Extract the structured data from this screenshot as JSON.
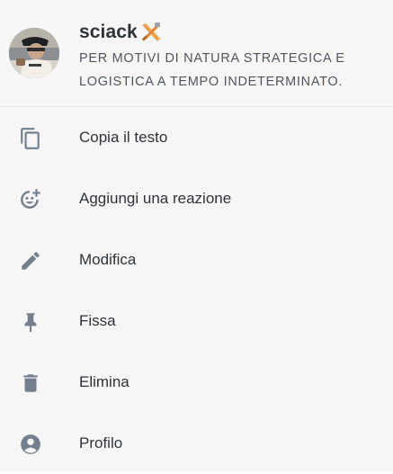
{
  "header": {
    "username": "sciack",
    "message": "PER MOTIVI DI NATURA STRATEGICA E LOGISTICA A TEMPO INDETERMINATO.",
    "badge_icon": "hammer-and-sword-icon",
    "avatar_icon": "user-avatar-photo"
  },
  "menu": {
    "items": [
      {
        "label": "Copia il testo",
        "icon": "copy-icon"
      },
      {
        "label": "Aggiungi una reazione",
        "icon": "add-reaction-icon"
      },
      {
        "label": "Modifica",
        "icon": "pencil-icon"
      },
      {
        "label": "Fissa",
        "icon": "pin-icon"
      },
      {
        "label": "Elimina",
        "icon": "trash-icon"
      },
      {
        "label": "Profilo",
        "icon": "profile-icon"
      }
    ]
  },
  "colors": {
    "background": "#f6f6f7",
    "text": "#2e3338",
    "secondary_text": "#4f5660",
    "icon": "#747f8d",
    "badge": "#f0a14a"
  }
}
